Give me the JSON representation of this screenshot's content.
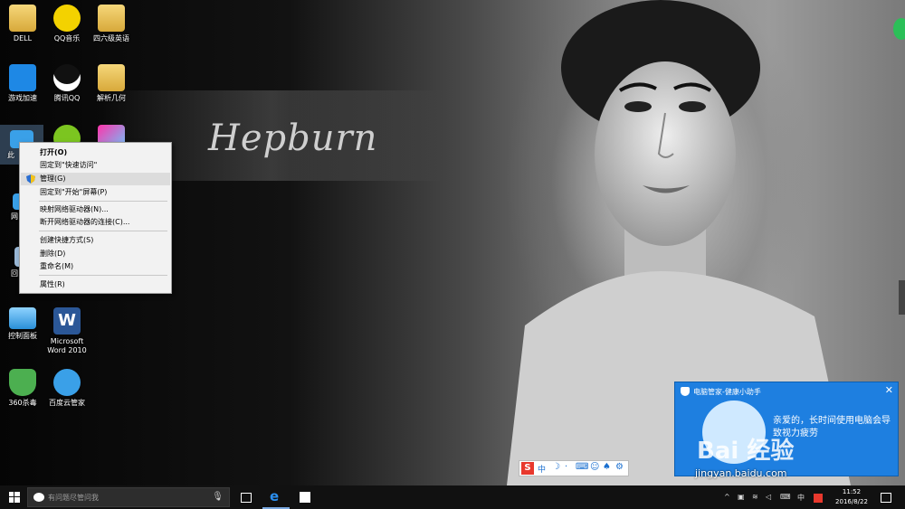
{
  "desktop": {
    "icons": [
      {
        "id": "dell",
        "label": "DELL"
      },
      {
        "id": "qqmusic",
        "label": "QQ音乐"
      },
      {
        "id": "cet46",
        "label": "四六级英语"
      },
      {
        "id": "game-accel",
        "label": "游戏加速"
      },
      {
        "id": "tencent-qq",
        "label": "腾讯QQ"
      },
      {
        "id": "geometry",
        "label": "解析几何"
      },
      {
        "id": "this-pc",
        "label": "此"
      },
      {
        "id": "network",
        "label": "网"
      },
      {
        "id": "recycle",
        "label": "回"
      },
      {
        "id": "control-panel",
        "label": "控制面板"
      },
      {
        "id": "word",
        "label": "Microsoft Word 2010"
      },
      {
        "id": "360",
        "label": "360杀毒"
      },
      {
        "id": "baidu-cloud",
        "label": "百度云管家"
      }
    ],
    "wallpaper_script": "Hepburn"
  },
  "context_menu": {
    "items": [
      {
        "label": "打开(O)",
        "bold": true
      },
      {
        "label": "固定到\"快速访问\""
      },
      {
        "label": "管理(G)",
        "highlighted": true,
        "shield_icon": true
      },
      {
        "label": "固定到\"开始\"屏幕(P)"
      },
      {
        "label": "映射网络驱动器(N)..."
      },
      {
        "label": "断开网络驱动器的连接(C)..."
      },
      {
        "label": "创建快捷方式(S)"
      },
      {
        "label": "删除(D)"
      },
      {
        "label": "重命名(M)"
      },
      {
        "label": "属性(R)"
      }
    ]
  },
  "popup": {
    "title": "电脑管家-健康小助手",
    "message": "亲爱的，长时间使用电脑会导致视力疲劳"
  },
  "watermark": {
    "logo": "Bai 经验",
    "url": "jingyan.baidu.com"
  },
  "taskbar": {
    "search_placeholder": "有问题尽管问我",
    "tray_ime": "中",
    "time": "11:52",
    "date": "2016/8/22"
  },
  "colors": {
    "popup_bg": "#1e7fe0",
    "menu_bg": "#f2f2f2",
    "menu_highlight": "#dcdcdc",
    "taskbar_bg": "#111111"
  }
}
